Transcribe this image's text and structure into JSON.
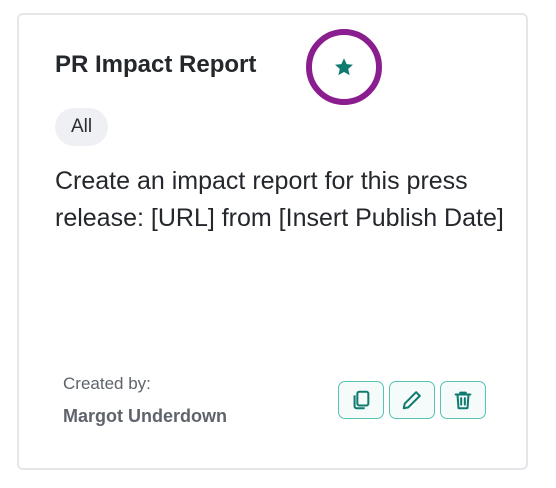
{
  "card": {
    "title": "PR Impact Report",
    "favorite_icon": "star-icon",
    "category_tag": "All",
    "description": "Create an impact report for this press release: [URL] from [Insert Publish Date]",
    "created_by_label": "Created by:",
    "creator_name": "Margot Underdown",
    "actions": [
      {
        "name": "copy",
        "icon": "copy-icon"
      },
      {
        "name": "edit",
        "icon": "pencil-icon"
      },
      {
        "name": "delete",
        "icon": "trash-icon"
      }
    ]
  },
  "colors": {
    "accent": "#0f7a6e",
    "action_border": "#58c2b5",
    "highlight_ring": "#8a1e8f",
    "tag_background": "#eef0f4",
    "card_border": "#e4e6ea"
  }
}
